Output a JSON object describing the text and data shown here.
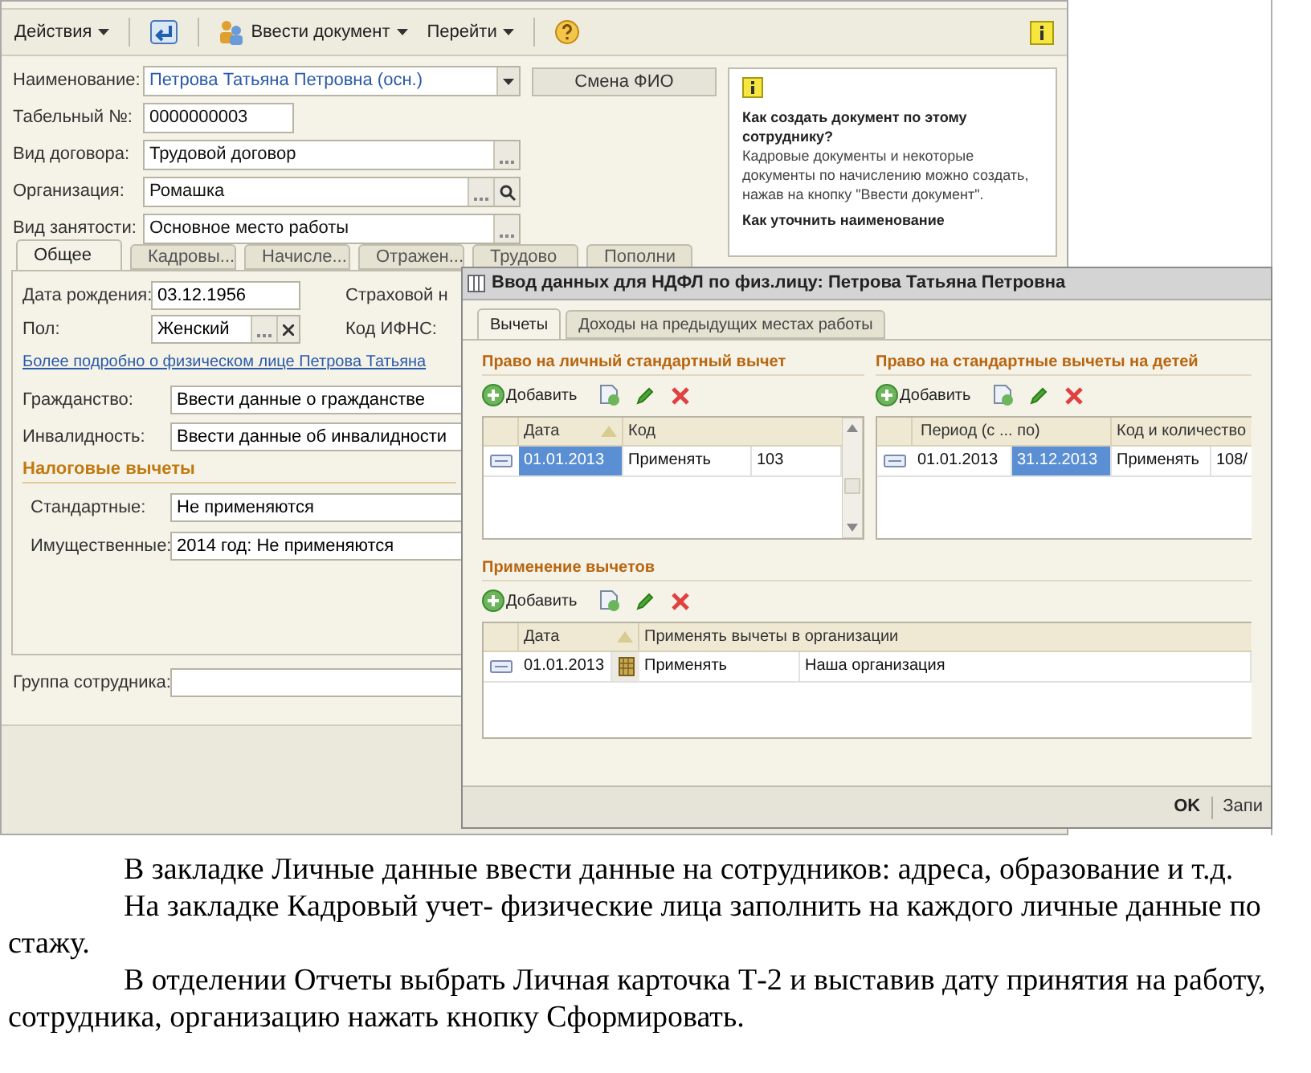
{
  "toolbar": {
    "actions": "Действия",
    "enter_document": "Ввести документ",
    "go_to": "Перейти"
  },
  "form": {
    "fields": [
      {
        "label": "Наименование:",
        "value": "Петрова Татьяна Петровна  (осн.)",
        "kind": "dropdown"
      },
      {
        "label": "Табельный №:",
        "value": "0000000003",
        "kind": "short"
      },
      {
        "label": "Вид договора:",
        "value": "Трудовой договор",
        "kind": "select"
      },
      {
        "label": "Организация:",
        "value": "Ромашка",
        "kind": "select_search"
      },
      {
        "label": "Вид занятости:",
        "value": "Основное место работы",
        "kind": "select"
      }
    ],
    "rename_button": "Смена ФИО"
  },
  "help_panel": {
    "question_1": "Как создать документ по этому сотруднику?",
    "answer_1": "Кадровые документы и некоторые документы по начислению можно создать, нажав на кнопку \"Ввести документ\".",
    "question_2": "Как уточнить наименование"
  },
  "tabs": [
    {
      "label": "Общее",
      "selected": true
    },
    {
      "label": "Кадровы...",
      "selected": false
    },
    {
      "label": "Начисле...",
      "selected": false
    },
    {
      "label": "Отражен...",
      "selected": false
    },
    {
      "label": "Трудово",
      "selected": false
    },
    {
      "label": "Пополни",
      "selected": false
    }
  ],
  "general": {
    "birth_date_label": "Дата рождения:",
    "birth_date": "03.12.1956",
    "insurance_label": "Страховой н",
    "gender_label": "Пол:",
    "gender": "Женский",
    "tax_office_label": "Код ИФНС:",
    "more_link": "Более подробно о физическом лице Петрова Татьяна",
    "rows": [
      {
        "label": "Гражданство:",
        "value": "Ввести данные о гражданстве"
      },
      {
        "label": "Инвалидность:",
        "value": "Ввести данные об инвалидности"
      }
    ],
    "deductions_heading": "Налоговые вычеты",
    "deductions": [
      {
        "label": "Стандартные:",
        "value": "Не применяются"
      },
      {
        "label": "Имущественные:",
        "value": "2014 год: Не применяются"
      }
    ]
  },
  "employee_group": {
    "label": "Группа сотрудника:"
  },
  "dialog": {
    "title": "Ввод данных для НДФЛ по физ.лицу: Петрова Татьяна Петровна",
    "tabs": [
      {
        "label": "Вычеты",
        "selected": true
      },
      {
        "label": "Доходы на предыдущих местах работы",
        "selected": false
      }
    ],
    "personal": {
      "heading": "Право на личный стандартный вычет",
      "add": "Добавить",
      "columns": [
        "Дата",
        "Код",
        ""
      ],
      "rows": [
        {
          "cells": [
            {
              "text": "01.01.2013",
              "selected": true
            },
            {
              "text": "Применять",
              "selected": false
            },
            {
              "text": "103",
              "selected": false
            }
          ]
        }
      ]
    },
    "children": {
      "heading": "Право на стандартные вычеты на детей",
      "add": "Добавить",
      "columns": [
        "Период (с ... по)",
        "",
        "Код и количество",
        ""
      ],
      "rows": [
        {
          "cells": [
            {
              "text": "01.01.2013",
              "selected": false
            },
            {
              "text": "31.12.2013",
              "selected": true
            },
            {
              "text": "Применять",
              "selected": false
            },
            {
              "text": "108/",
              "selected": false
            }
          ]
        }
      ]
    },
    "application": {
      "heading": "Применение вычетов",
      "add": "Добавить",
      "columns": [
        "Дата",
        "Применять вычеты в организации",
        ""
      ],
      "rows": [
        {
          "cells": [
            {
              "text": "01.01.2013",
              "selected": false
            },
            {
              "text": "Применять",
              "selected": false
            },
            {
              "text": "Наша организация",
              "selected": false
            }
          ]
        }
      ]
    },
    "ok": "OK",
    "save": "Запи"
  },
  "document_text": [
    "В закладке Личные данные ввести данные на сотрудников: адреса, образование и т.д.",
    "На закладке Кадровый учет- физические лица заполнить на каждого личные данные по стажу.",
    "В отделении Отчеты выбрать Личная карточка Т-2 и выставив дату принятия на работу, сотрудника, организацию нажать кнопку Сформировать."
  ]
}
